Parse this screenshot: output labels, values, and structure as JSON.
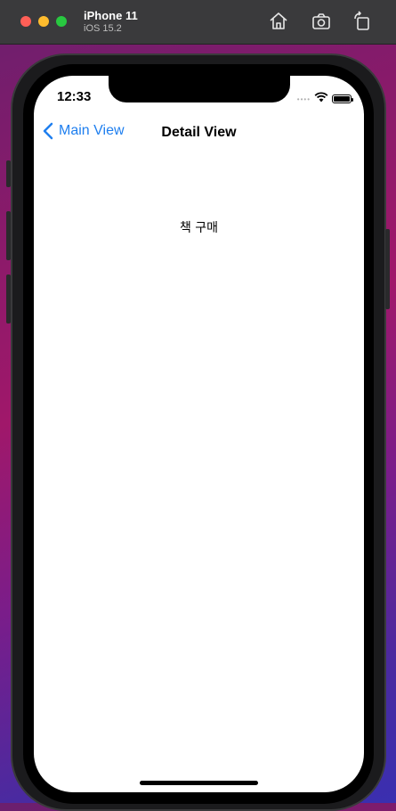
{
  "simulator": {
    "device_name": "iPhone 11",
    "os_version": "iOS 15.2",
    "icons": [
      "home-icon",
      "screenshot-icon",
      "rotate-icon"
    ]
  },
  "status_bar": {
    "time": "12:33"
  },
  "navigation": {
    "back_label": "Main View",
    "title": "Detail View"
  },
  "content": {
    "text": "책 구매"
  },
  "colors": {
    "accent": "#1f7fef"
  }
}
